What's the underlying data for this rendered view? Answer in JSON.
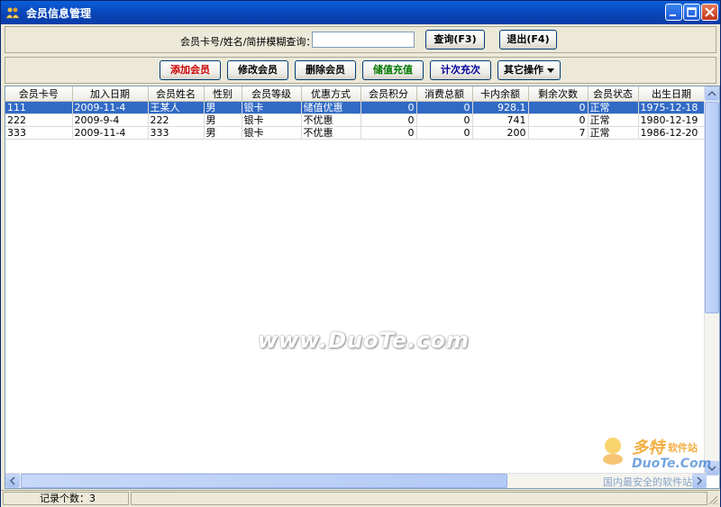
{
  "window": {
    "title": "会员信息管理"
  },
  "search": {
    "label": "会员卡号/姓名/简拼模糊查询：",
    "value": "",
    "query_button": "查询(F3)",
    "exit_button": "退出(F4)"
  },
  "toolbar": {
    "add": "添加会员",
    "edit": "修改会员",
    "delete": "删除会员",
    "recharge": "储值充值",
    "count_recharge": "计次充次",
    "other": "其它操作",
    "colors": {
      "add": "#cc0000",
      "recharge": "#007700",
      "count_recharge": "#000099"
    }
  },
  "table": {
    "columns": [
      "会员卡号",
      "加入日期",
      "会员姓名",
      "性别",
      "会员等级",
      "优惠方式",
      "会员积分",
      "消费总额",
      "卡内余额",
      "剩余次数",
      "会员状态",
      "出生日期"
    ],
    "rows": [
      [
        "111",
        "2009-11-4",
        "王某人",
        "男",
        "银卡",
        "储值优惠",
        "0",
        "0",
        "928.1",
        "0",
        "正常",
        "1975-12-18"
      ],
      [
        "222",
        "2009-9-4",
        "222",
        "男",
        "银卡",
        "不优惠",
        "0",
        "0",
        "741",
        "0",
        "正常",
        "1980-12-19"
      ],
      [
        "333",
        "2009-11-4",
        "333",
        "男",
        "银卡",
        "不优惠",
        "0",
        "0",
        "200",
        "7",
        "正常",
        "1986-12-20"
      ]
    ],
    "selected_row": 0
  },
  "status": {
    "record_count": "记录个数：3"
  },
  "watermark": {
    "center": "www.DuoTe.com",
    "logo_name": "多特",
    "logo_sub": "软件站",
    "logo_url": "DuoTe.Com",
    "tagline": "国内最安全的软件站"
  }
}
